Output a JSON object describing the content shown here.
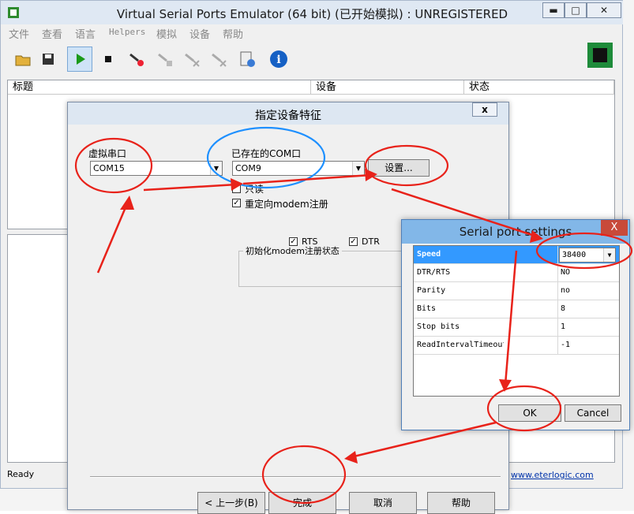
{
  "window": {
    "title": "Virtual Serial Ports Emulator (64 bit) (已开始模拟) : UNREGISTERED",
    "controls": {
      "minimize": "▬",
      "maximize": "□",
      "close": "✕"
    }
  },
  "menu": [
    "文件",
    "查看",
    "语言",
    "Helpers",
    "模拟",
    "设备",
    "帮助"
  ],
  "toolbar": {
    "icons": [
      "open-folder-icon",
      "save-icon",
      "play-icon",
      "stop-icon",
      "device-new-icon",
      "device-edit-icon",
      "device-delete-icon",
      "device-disconnect-icon",
      "log-icon",
      "info-icon"
    ]
  },
  "list": {
    "columns": [
      "标题",
      "设备",
      "状态"
    ]
  },
  "status": {
    "text": "Ready",
    "link": "www.eterlogic.com"
  },
  "dialog": {
    "title": "指定设备特征",
    "close": "x",
    "virtual_port_label": "虚拟串口",
    "virtual_port_value": "COM15",
    "existing_port_label": "已存在的COM口",
    "existing_port_value": "COM9",
    "settings_button": "设置...",
    "readonly_label": "只读",
    "redirect_label": "重定向modem注册",
    "init_group_label": "初始化modem注册状态",
    "rts_label": "RTS",
    "dtr_label": "DTR",
    "prev_button": "< 上一步(B)",
    "finish_button": "完成",
    "cancel_button": "取消",
    "help_button": "帮助"
  },
  "serial": {
    "title": "Serial port settings",
    "close": "X",
    "rows": [
      {
        "name": "Speed",
        "value": "38400"
      },
      {
        "name": "DTR/RTS",
        "value": "NO"
      },
      {
        "name": "Parity",
        "value": "no"
      },
      {
        "name": "Bits",
        "value": "8"
      },
      {
        "name": "Stop bits",
        "value": "1"
      },
      {
        "name": "ReadIntervalTimeout",
        "value": "-1"
      }
    ],
    "ok_button": "OK",
    "cancel_button": "Cancel"
  },
  "colors": {
    "highlight": "#3399ff",
    "annotation": "#e8221a",
    "circle_blue": "#1e90ff"
  }
}
